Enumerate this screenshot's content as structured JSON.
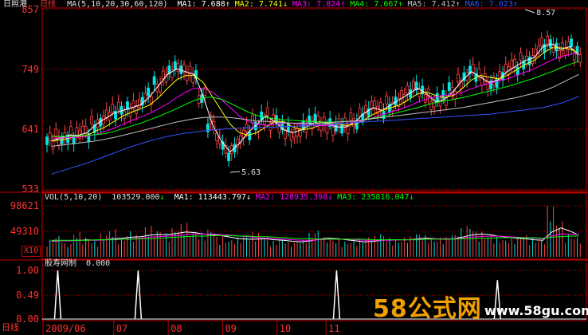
{
  "header": {
    "stock_name": "日照港",
    "period": "日线",
    "ma_params": "MA(5,10,20,30,60,120)",
    "ma_values": [
      {
        "label": "MA1:",
        "value": "7.688",
        "arrow": "↑",
        "color": "#ffffff"
      },
      {
        "label": "MA2:",
        "value": "7.741",
        "arrow": "↓",
        "color": "#ffff00"
      },
      {
        "label": "MA3:",
        "value": "7.824",
        "arrow": "↑",
        "color": "#ff00ff"
      },
      {
        "label": "MA4:",
        "value": "7.667",
        "arrow": "↑",
        "color": "#00ff00"
      },
      {
        "label": "MA5:",
        "value": "7.412",
        "arrow": "↑",
        "color": "#c0c0c0"
      },
      {
        "label": "MA6:",
        "value": "7.023",
        "arrow": "↑",
        "color": "#3355ff"
      }
    ]
  },
  "volume_header": {
    "params": "VOL(5,10,20)",
    "vol_value": "103529.000",
    "vol_arrow": "↓",
    "ma_values": [
      {
        "label": "MA1:",
        "value": "113443.797",
        "arrow": "↓",
        "color": "#ffffff"
      },
      {
        "label": "MA2:",
        "value": "128935.398",
        "arrow": "↓",
        "color": "#ff00ff"
      },
      {
        "label": "MA3:",
        "value": "235816.047",
        "arrow": "↓",
        "color": "#00ff00"
      }
    ]
  },
  "indicator_header": {
    "name": "股寿网制",
    "value": "0.000"
  },
  "bottom": {
    "period": "日线",
    "unit_label": "X10"
  },
  "watermark": {
    "text": "58公式网",
    "url": "www.58gu.com"
  },
  "colors": {
    "up": "#ff4444",
    "down": "#00e5e5",
    "axis": "#c00000",
    "label": "#ff3030"
  },
  "chart_data": [
    {
      "type": "candlestick",
      "yticks": [
        "857",
        "749",
        "641",
        "533"
      ],
      "ytick_values": [
        8.57,
        7.49,
        6.41,
        5.33
      ],
      "ylim": [
        5.33,
        8.57
      ],
      "xticks": [
        "2009/06",
        "07",
        "08",
        "09",
        "10",
        "11"
      ],
      "annotations": [
        {
          "text": "8.57",
          "value": 8.57
        },
        {
          "text": "5.63",
          "value": 5.63
        }
      ],
      "series": [
        {
          "name": "MA1",
          "color": "#ffffff",
          "values": [
            6.2,
            6.25,
            6.3,
            6.3,
            6.35,
            6.5,
            6.6,
            6.7,
            6.75,
            6.8,
            6.85,
            7.0,
            7.2,
            7.4,
            7.5,
            7.45,
            7.4,
            7.0,
            6.5,
            6.2,
            6.0,
            6.15,
            6.35,
            6.5,
            6.65,
            6.55,
            6.4,
            6.35,
            6.4,
            6.5,
            6.55,
            6.5,
            6.45,
            6.45,
            6.55,
            6.7,
            6.8,
            6.75,
            6.85,
            6.95,
            7.05,
            7.15,
            7.05,
            6.9,
            6.95,
            7.1,
            7.3,
            7.45,
            7.35,
            7.25,
            7.3,
            7.45,
            7.55,
            7.65,
            7.7,
            7.9,
            7.95,
            7.85,
            7.9,
            7.75
          ]
        },
        {
          "name": "MA2",
          "color": "#ffff00",
          "values": [
            6.2,
            6.22,
            6.25,
            6.28,
            6.3,
            6.38,
            6.45,
            6.55,
            6.65,
            6.72,
            6.78,
            6.85,
            6.98,
            7.15,
            7.3,
            7.38,
            7.38,
            7.25,
            7.0,
            6.75,
            6.5,
            6.35,
            6.3,
            6.35,
            6.45,
            6.55,
            6.55,
            6.45,
            6.4,
            6.42,
            6.48,
            6.52,
            6.5,
            6.48,
            6.5,
            6.58,
            6.68,
            6.75,
            6.8,
            6.85,
            6.95,
            7.05,
            7.08,
            7.02,
            6.98,
            7.02,
            7.15,
            7.3,
            7.38,
            7.35,
            7.32,
            7.38,
            7.48,
            7.58,
            7.65,
            7.78,
            7.88,
            7.88,
            7.86,
            7.78
          ]
        },
        {
          "name": "MA3",
          "color": "#ff00ff",
          "values": [
            6.25,
            6.25,
            6.26,
            6.27,
            6.28,
            6.32,
            6.37,
            6.43,
            6.5,
            6.57,
            6.63,
            6.7,
            6.78,
            6.87,
            6.98,
            7.08,
            7.15,
            7.15,
            7.08,
            6.95,
            6.8,
            6.65,
            6.55,
            6.5,
            6.48,
            6.5,
            6.52,
            6.52,
            6.5,
            6.48,
            6.47,
            6.48,
            6.5,
            6.52,
            6.54,
            6.57,
            6.62,
            6.67,
            6.72,
            6.77,
            6.83,
            6.9,
            6.96,
            7.0,
            7.02,
            7.04,
            7.08,
            7.14,
            7.2,
            7.24,
            7.28,
            7.32,
            7.38,
            7.44,
            7.5,
            7.58,
            7.66,
            7.72,
            7.76,
            7.78
          ]
        },
        {
          "name": "MA4",
          "color": "#00ff00",
          "values": [
            6.28,
            6.28,
            6.28,
            6.29,
            6.3,
            6.31,
            6.33,
            6.37,
            6.42,
            6.47,
            6.52,
            6.58,
            6.64,
            6.71,
            6.78,
            6.86,
            6.93,
            6.98,
            6.99,
            6.95,
            6.88,
            6.8,
            6.72,
            6.66,
            6.62,
            6.6,
            6.58,
            6.57,
            6.56,
            6.55,
            6.54,
            6.54,
            6.54,
            6.55,
            6.56,
            6.58,
            6.61,
            6.64,
            6.68,
            6.72,
            6.76,
            6.8,
            6.85,
            6.89,
            6.92,
            6.95,
            6.98,
            7.02,
            7.06,
            7.1,
            7.14,
            7.18,
            7.23,
            7.28,
            7.33,
            7.39,
            7.45,
            7.52,
            7.58,
            7.64
          ]
        },
        {
          "name": "MA5",
          "color": "#c0c0c0",
          "values": [
            6.1,
            6.12,
            6.14,
            6.16,
            6.18,
            6.2,
            6.23,
            6.26,
            6.3,
            6.34,
            6.38,
            6.42,
            6.46,
            6.5,
            6.54,
            6.57,
            6.6,
            6.62,
            6.63,
            6.63,
            6.62,
            6.6,
            6.58,
            6.56,
            6.55,
            6.54,
            6.53,
            6.52,
            6.52,
            6.52,
            6.52,
            6.53,
            6.54,
            6.55,
            6.56,
            6.58,
            6.6,
            6.62,
            6.64,
            6.66,
            6.68,
            6.7,
            6.72,
            6.74,
            6.76,
            6.78,
            6.8,
            6.83,
            6.86,
            6.89,
            6.92,
            6.95,
            6.98,
            7.02,
            7.06,
            7.1,
            7.16,
            7.24,
            7.32,
            7.4
          ]
        },
        {
          "name": "MA6",
          "color": "#3355ff",
          "values": [
            5.6,
            5.65,
            5.7,
            5.75,
            5.8,
            5.86,
            5.92,
            5.98,
            6.04,
            6.1,
            6.15,
            6.2,
            6.24,
            6.28,
            6.31,
            6.34,
            6.36,
            6.38,
            6.4,
            6.41,
            6.42,
            6.43,
            6.44,
            6.44,
            6.45,
            6.45,
            6.46,
            6.46,
            6.47,
            6.48,
            6.49,
            6.5,
            6.51,
            6.52,
            6.53,
            6.54,
            6.55,
            6.56,
            6.57,
            6.58,
            6.59,
            6.6,
            6.61,
            6.62,
            6.63,
            6.64,
            6.65,
            6.66,
            6.67,
            6.68,
            6.7,
            6.72,
            6.74,
            6.76,
            6.78,
            6.8,
            6.84,
            6.88,
            6.94,
            7.0
          ]
        }
      ]
    },
    {
      "type": "bar",
      "name": "VOL",
      "yticks": [
        "98621",
        "49310"
      ],
      "ytick_values": [
        98621,
        49310
      ],
      "ylim": [
        0,
        98621
      ],
      "values": [
        2.8,
        3.5,
        2.2,
        4.0,
        3.2,
        2.6,
        3.8,
        4.5,
        3.0,
        4.2,
        3.6,
        5.0,
        4.4,
        3.8,
        4.8,
        5.5,
        4.2,
        3.9,
        4.6,
        3.3,
        2.8,
        3.1,
        3.5,
        4.0,
        3.4,
        2.6,
        3.0,
        2.4,
        2.8,
        3.9,
        4.4,
        3.2,
        2.9,
        2.5,
        2.7,
        3.0,
        3.4,
        3.8,
        3.1,
        2.8,
        3.3,
        3.9,
        3.5,
        2.9,
        3.2,
        3.8,
        4.6,
        5.2,
        4.1,
        3.6,
        3.2,
        2.9,
        3.3,
        3.6,
        3.0,
        2.8,
        8.5,
        5.8,
        3.8,
        3.2
      ],
      "ma_series": [
        {
          "name": "MA1",
          "color": "#ffffff",
          "values": [
            3.0,
            3.1,
            3.1,
            3.2,
            3.3,
            3.2,
            3.3,
            3.5,
            3.6,
            3.8,
            3.9,
            4.2,
            4.3,
            4.3,
            4.5,
            4.8,
            4.7,
            4.4,
            4.3,
            4.1,
            3.8,
            3.5,
            3.4,
            3.4,
            3.5,
            3.3,
            3.2,
            3.0,
            2.9,
            3.1,
            3.4,
            3.6,
            3.5,
            3.3,
            3.1,
            2.9,
            3.0,
            3.2,
            3.3,
            3.3,
            3.3,
            3.5,
            3.6,
            3.5,
            3.4,
            3.5,
            3.8,
            4.2,
            4.4,
            4.3,
            4.0,
            3.8,
            3.6,
            3.5,
            3.3,
            3.2,
            4.8,
            5.6,
            5.0,
            4.2
          ]
        },
        {
          "name": "MA2",
          "color": "#ff00ff",
          "values": [
            3.1,
            3.1,
            3.1,
            3.2,
            3.2,
            3.2,
            3.3,
            3.4,
            3.4,
            3.5,
            3.6,
            3.8,
            3.9,
            4.0,
            4.1,
            4.3,
            4.4,
            4.4,
            4.4,
            4.3,
            4.2,
            4.0,
            3.9,
            3.7,
            3.6,
            3.5,
            3.4,
            3.3,
            3.2,
            3.2,
            3.3,
            3.4,
            3.4,
            3.4,
            3.3,
            3.2,
            3.2,
            3.2,
            3.2,
            3.3,
            3.3,
            3.4,
            3.4,
            3.5,
            3.5,
            3.5,
            3.6,
            3.8,
            3.9,
            4.0,
            4.0,
            3.9,
            3.8,
            3.7,
            3.6,
            3.5,
            4.0,
            4.4,
            4.4,
            4.3
          ]
        },
        {
          "name": "MA3",
          "color": "#00ff00",
          "values": [
            3.2,
            3.2,
            3.2,
            3.2,
            3.2,
            3.3,
            3.3,
            3.3,
            3.4,
            3.4,
            3.5,
            3.5,
            3.6,
            3.7,
            3.8,
            3.9,
            4.0,
            4.0,
            4.1,
            4.1,
            4.1,
            4.0,
            4.0,
            3.9,
            3.9,
            3.8,
            3.7,
            3.6,
            3.5,
            3.5,
            3.4,
            3.4,
            3.4,
            3.4,
            3.4,
            3.4,
            3.3,
            3.3,
            3.3,
            3.3,
            3.3,
            3.3,
            3.4,
            3.4,
            3.4,
            3.4,
            3.5,
            3.5,
            3.6,
            3.6,
            3.7,
            3.7,
            3.7,
            3.7,
            3.7,
            3.6,
            3.8,
            3.9,
            4.0,
            4.0
          ]
        }
      ]
    },
    {
      "type": "line",
      "name": "股寿网制",
      "yticks": [
        "1.00",
        "0.49",
        "0.00"
      ],
      "ytick_values": [
        1.0,
        0.49,
        0.0
      ],
      "ylim": [
        0,
        1
      ],
      "spikes": [
        {
          "position": 0.02,
          "value": 1.0
        },
        {
          "position": 0.17,
          "value": 1.0
        },
        {
          "position": 0.54,
          "value": 1.0
        },
        {
          "position": 0.84,
          "value": 0.8
        }
      ]
    }
  ]
}
